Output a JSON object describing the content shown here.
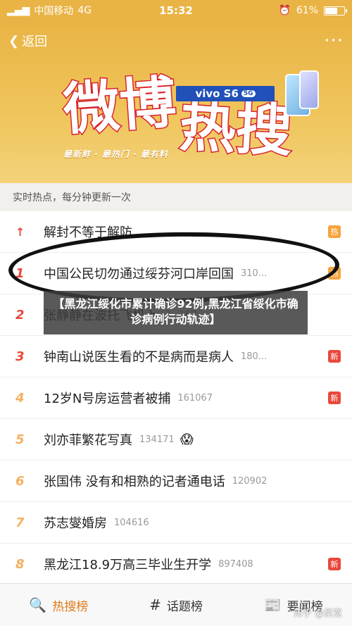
{
  "status_bar": {
    "carrier": "中国移动",
    "network": "4G",
    "time": "15:32",
    "battery": "61%",
    "battery_level": 0.61
  },
  "nav": {
    "back_label": "返回",
    "more_label": "···"
  },
  "hero": {
    "title_part1": "微博",
    "title_part2": "热搜",
    "tagline": "最新鲜 · 最热门 · 最有料",
    "sponsor": "vivo S6",
    "sponsor_tag": "5G"
  },
  "subheader": "实时热点，每分钟更新一次",
  "items": [
    {
      "rank": "↑",
      "title": "解封不等于解防",
      "count": "",
      "badge": "热",
      "badge_type": "hot",
      "emoji": ""
    },
    {
      "rank": "1",
      "title": "中国公民切勿通过绥芬河口岸回国",
      "count": "310...",
      "badge": "热",
      "badge_type": "hot",
      "emoji": ""
    },
    {
      "rank": "2",
      "title": "张静静在波托飞机上",
      "count": "3...167",
      "badge": "",
      "badge_type": "",
      "emoji": ""
    },
    {
      "rank": "3",
      "title": "钟南山说医生看的不是病而是病人",
      "count": "180...",
      "badge": "新",
      "badge_type": "new",
      "emoji": ""
    },
    {
      "rank": "4",
      "title": "12岁N号房运营者被捕",
      "count": "1610675",
      "badge": "新",
      "badge_type": "new",
      "emoji": ""
    },
    {
      "rank": "5",
      "title": "刘亦菲繁花写真",
      "count": "1341719",
      "badge": "",
      "badge_type": "",
      "emoji": "😱"
    },
    {
      "rank": "6",
      "title": "张国伟 没有和相熟的记者通电话",
      "count": "1209029",
      "badge": "",
      "badge_type": "",
      "emoji": ""
    },
    {
      "rank": "7",
      "title": "苏志燮婚房",
      "count": "1046162",
      "badge": "",
      "badge_type": "",
      "emoji": ""
    },
    {
      "rank": "8",
      "title": "黑龙江18.9万高三毕业生开学",
      "count": "897408",
      "badge": "新",
      "badge_type": "new",
      "emoji": ""
    }
  ],
  "caption": "【黑龙江绥化市累计确诊92例,黑龙江省绥化市确诊病例行动轨迹】",
  "tabs": [
    {
      "label": "热搜榜",
      "icon": "🔍"
    },
    {
      "label": "话题榜",
      "icon": "#"
    },
    {
      "label": "要闻榜",
      "icon": "📰"
    }
  ],
  "watermark": "知乎 @梁宽",
  "colors": {
    "accent": "#e9b445",
    "hot": "#f6a33b",
    "new": "#e9483b",
    "active_tab": "#e07a18"
  }
}
